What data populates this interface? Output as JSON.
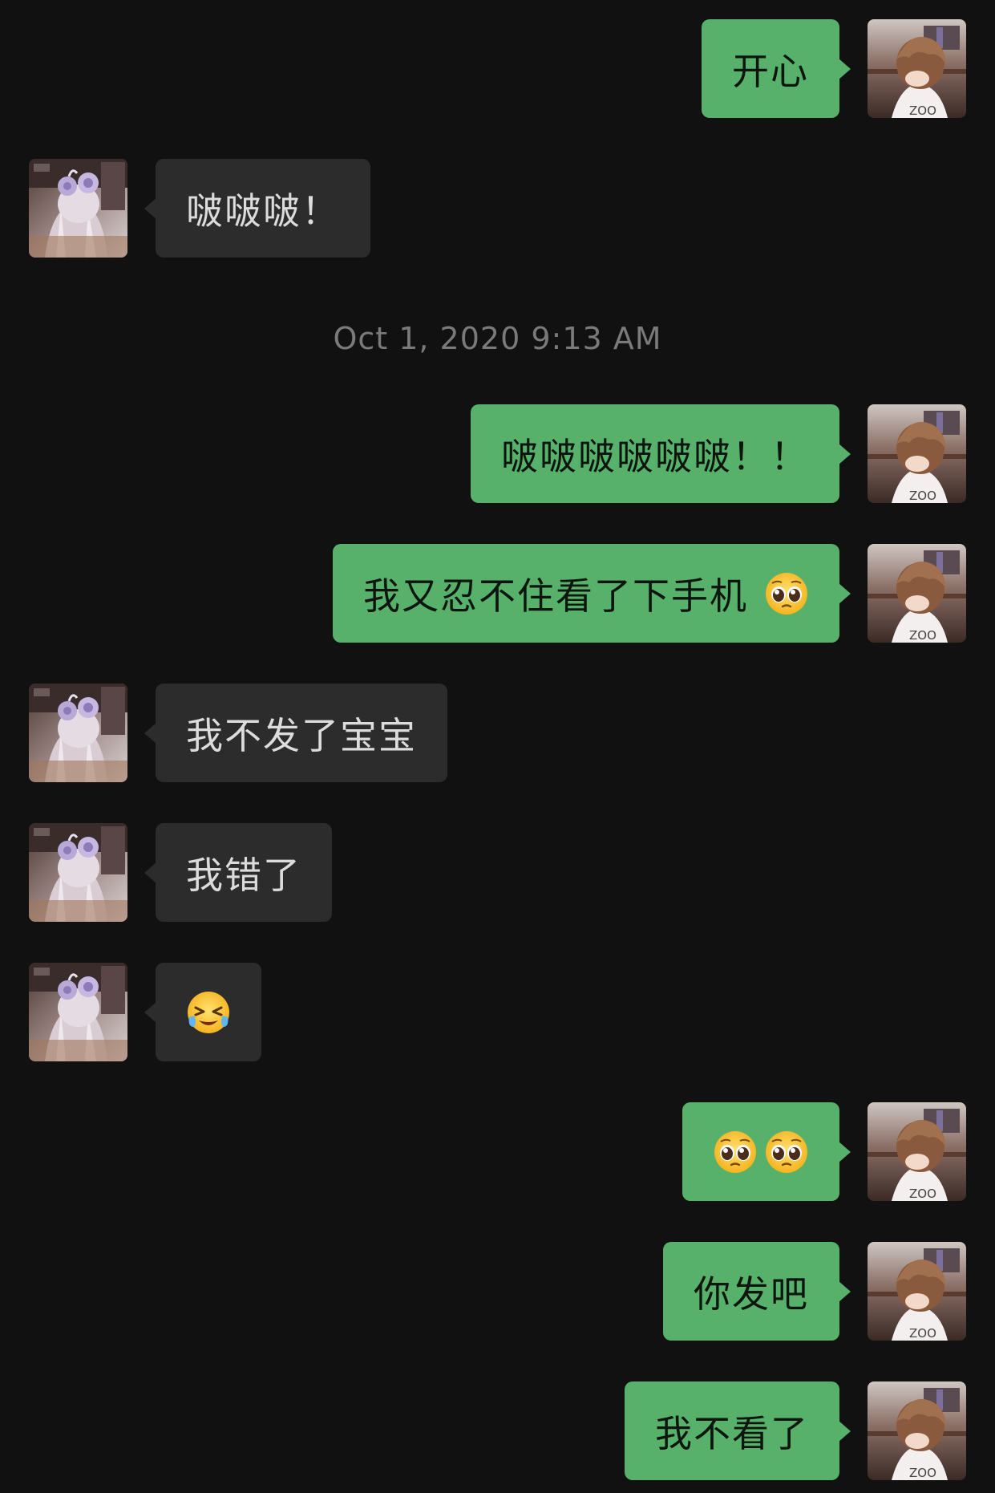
{
  "colors": {
    "background": "#111111",
    "outgoing_bubble": "#57b16a",
    "incoming_bubble": "#2c2c2c",
    "timestamp_text": "#7a7a7a"
  },
  "timestamp": "Oct 1, 2020 9:13 AM",
  "messages": [
    {
      "sender": "me",
      "text": "开心"
    },
    {
      "sender": "them",
      "text": "啵啵啵！"
    },
    {
      "sender": "me",
      "text": "啵啵啵啵啵啵！！"
    },
    {
      "sender": "me",
      "text": "我又忍不住看了下手机",
      "emoji": "pleading-face-icon"
    },
    {
      "sender": "them",
      "text": "我不发了宝宝"
    },
    {
      "sender": "them",
      "text": "我错了"
    },
    {
      "sender": "them",
      "emoji": "crying-laughing-face-icon"
    },
    {
      "sender": "me",
      "emoji": "pleading-face-icon x2"
    },
    {
      "sender": "me",
      "text": "你发吧"
    },
    {
      "sender": "me",
      "text": "我不看了"
    }
  ]
}
